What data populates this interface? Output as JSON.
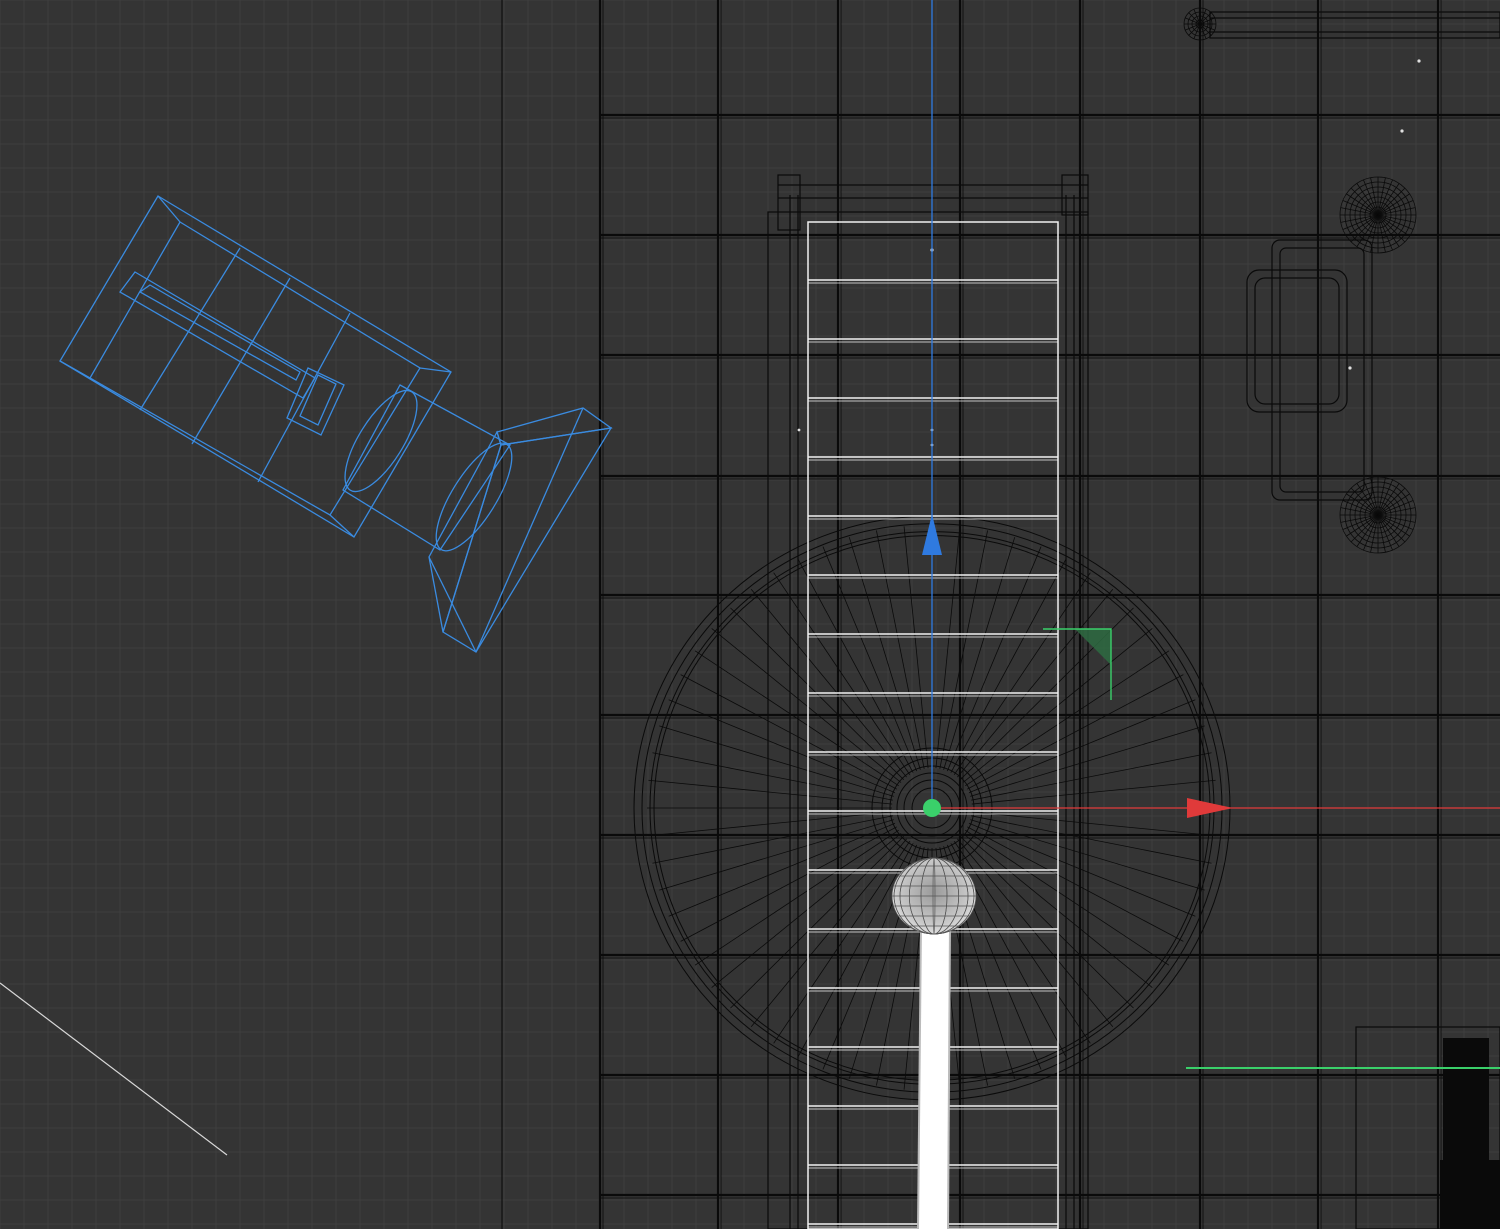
{
  "viewport": {
    "name": "3D viewport",
    "background_color": "#343434",
    "grid_color": "#3e3e3e",
    "wire_color": "#0a0a0a",
    "selection_color": "#3a8be0",
    "highlight_color": "#ffffff",
    "axis_x_color": "#e03a3a",
    "axis_y_color": "#3ad06a",
    "axis_z_color": "#2f7ae0"
  },
  "objects": [
    {
      "id": "camera",
      "label": "selected-camera-wireframe",
      "selected": true
    },
    {
      "id": "ladder",
      "label": "highlighted-ladder-mesh",
      "selected": false
    },
    {
      "id": "wheel",
      "label": "wheel-mesh",
      "selected": false
    },
    {
      "id": "sphere",
      "label": "sphere-mesh",
      "selected": false
    },
    {
      "id": "beam",
      "label": "light-beam-mesh",
      "selected": false
    }
  ],
  "gizmo": {
    "icons": [
      "move-x-arrow-icon",
      "move-z-arrow-icon",
      "plane-handle-icon",
      "pivot-center-icon"
    ]
  }
}
